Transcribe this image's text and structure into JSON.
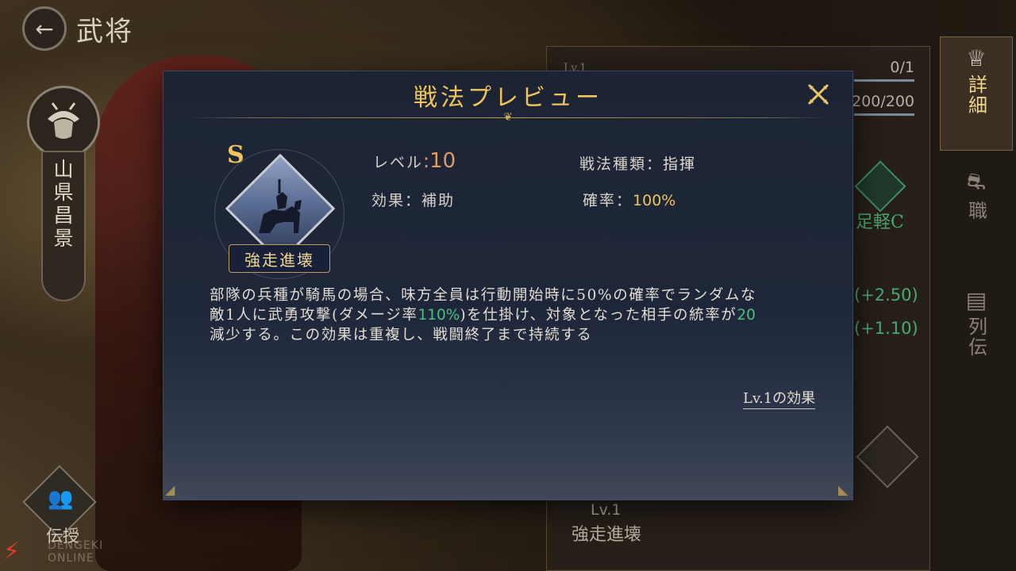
{
  "header": {
    "back_icon": "arrow-left-icon",
    "title": "武将"
  },
  "general": {
    "name": "山県昌景",
    "succession_label": "伝授"
  },
  "background_panel": {
    "level_small": "Lv.1",
    "count_1": "0/1",
    "count_2": "200/200",
    "troop_type": "足軽C",
    "stat_1": "(+2.50)",
    "stat_2": "(+1.10)",
    "skill_level": "Lv.1",
    "skill_name": "強走進壊"
  },
  "side_tabs": [
    {
      "label": "詳細",
      "icon": "helmet-icon",
      "active": true
    },
    {
      "label": "職",
      "icon": "armor-icon",
      "active": false
    },
    {
      "label": "列伝",
      "icon": "scroll-icon",
      "active": false
    }
  ],
  "logo": {
    "text": "DENGEKI ONLINE"
  },
  "modal": {
    "title": "戦法プレビュー",
    "close_icon": "close-x-icon",
    "skill": {
      "rank": "S",
      "name": "強走進壊"
    },
    "stats": {
      "level_label": "レベル",
      "level_sep": ":",
      "level_value": "10",
      "type_label": "戦法種類：",
      "type_value": "指揮",
      "effect_label": "効果：",
      "effect_value": "補助",
      "rate_label": "確率：",
      "rate_value": "100%"
    },
    "description": {
      "line1": "部隊の兵種が騎馬の場合、味方全員は行動開始時に50%の確率でランダムな",
      "line2_a": "敵1人に武勇攻撃(ダメージ率",
      "line2_hl": "110%",
      "line2_b": ")を仕掛け、対象となった相手の統率が",
      "line2_hl2": "20",
      "line3": "減少する。この効果は重複し、戦闘終了まで持続する"
    },
    "lv1_link": "Lv.1の効果"
  },
  "colors": {
    "gold": "#f0c45a",
    "highlight_green": "#48c07e",
    "modal_bg": "#1e2739"
  }
}
